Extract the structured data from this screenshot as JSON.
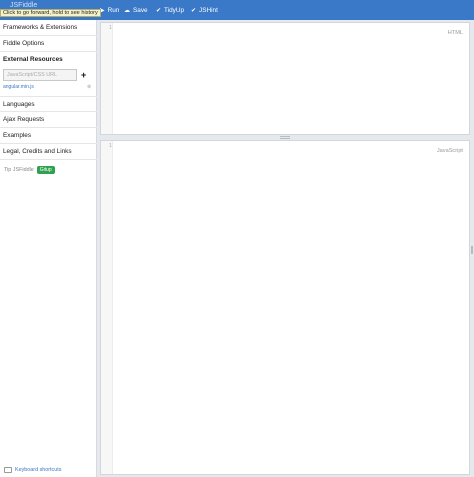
{
  "toolbar": {
    "logo": "JSFiddle",
    "tooltip": "Click to go forward, hold to see history",
    "buttons": [
      {
        "label": "Run",
        "icon": "play-icon"
      },
      {
        "label": "Save",
        "icon": "cloud-upload-icon"
      },
      {
        "label": "TidyUp",
        "icon": "check-icon"
      },
      {
        "label": "JSHint",
        "icon": "check-icon"
      }
    ]
  },
  "sidebar": {
    "frameworks": "Frameworks & Extensions",
    "fiddle_options": "Fiddle Options",
    "external_resources": "External Resources",
    "resource_placeholder": "JavaScript/CSS URL",
    "resource_add": "+",
    "resource_link": "angular.min.js",
    "resource_remove": "⊗",
    "languages": "Languages",
    "ajax": "Ajax Requests",
    "examples": "Examples",
    "legal": "Legal, Credits and Links",
    "tidy_label": "Tip JSFiddle",
    "tidy_badge": "Gitup",
    "shortcuts": "Keyboard shortcuts"
  },
  "editors": {
    "html": {
      "label": "HTML",
      "line": "1"
    },
    "js": {
      "label": "JavaScript",
      "line": "1"
    }
  }
}
